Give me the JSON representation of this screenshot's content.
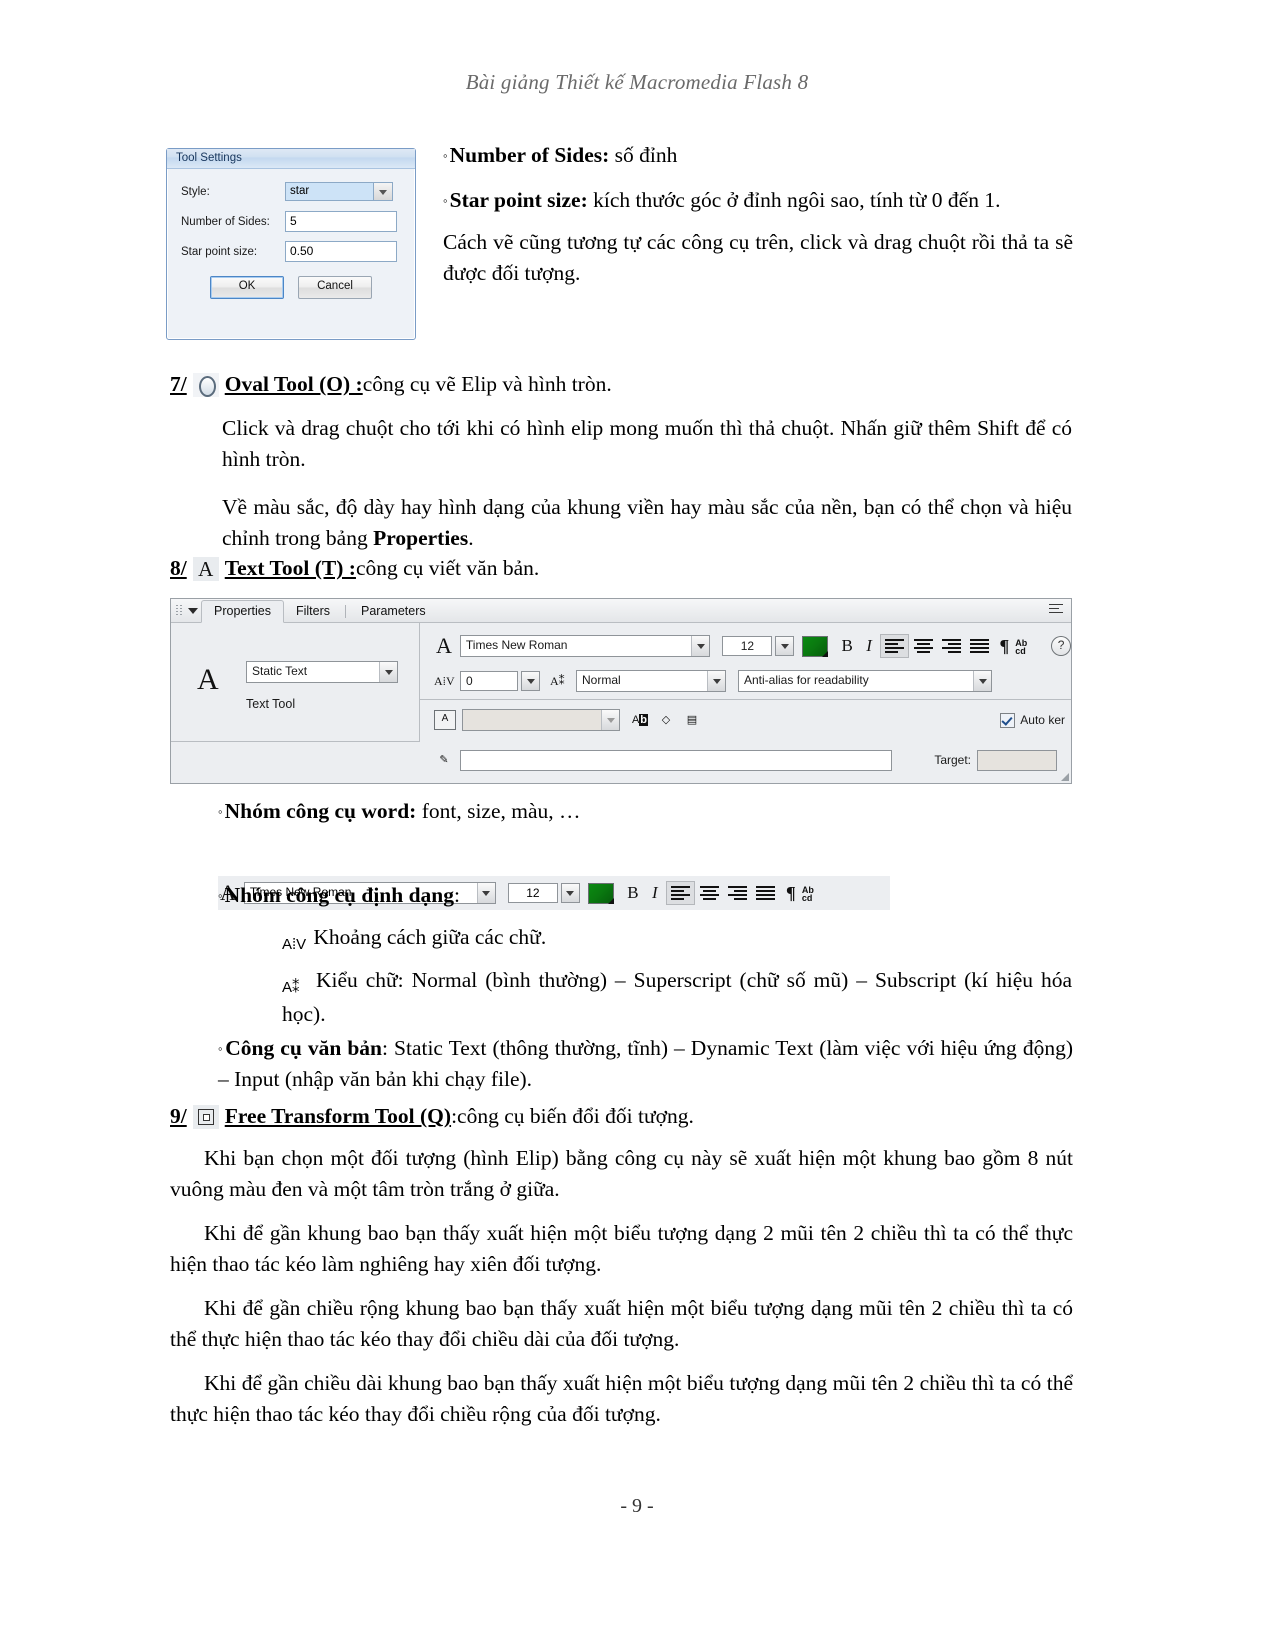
{
  "document": {
    "header": "Bài giảng Thiết kế Macromedia Flash 8",
    "page_number": "- 9 -"
  },
  "tool_settings_dialog": {
    "title": "Tool Settings",
    "fields": [
      {
        "label": "Style:",
        "value": "star",
        "type": "combo"
      },
      {
        "label": "Number of Sides:",
        "value": "5",
        "type": "input"
      },
      {
        "label": "Star point size:",
        "value": "0.50",
        "type": "input"
      }
    ],
    "ok_label": "OK",
    "cancel_label": "Cancel"
  },
  "bullets_top": {
    "b1_term": "Number of Sides:",
    "b1_desc": " số đỉnh",
    "b2_term": "Star point size:",
    "b2_desc": " kích thước góc ở đỉnh ngôi sao, tính từ 0 đến 1.",
    "p1": "Cách vẽ cũng tương tự các công cụ trên, click và drag chuột rồi thả ta sẽ được đối tượng."
  },
  "section_oval": {
    "number": "7/",
    "title": "Oval Tool (O) :",
    "tail": " công cụ vẽ Elip và hình tròn.",
    "p1": "Click và drag chuột cho tới khi có hình elip mong muốn thì thả chuột. Nhấn giữ thêm Shift để có hình tròn.",
    "p2_a": "Về màu sắc, độ dày hay hình dạng của khung viền hay màu sắc của nền, bạn có thể chọn và hiệu chỉnh trong bảng ",
    "p2_b": "Properties",
    "p2_c": "."
  },
  "section_text": {
    "number": "8/",
    "title": "Text Tool (T) :",
    "tail": "công cụ viết văn bản."
  },
  "properties_panel": {
    "tabs": [
      {
        "label": "Properties",
        "active": true
      },
      {
        "label": "Filters",
        "active": false
      },
      {
        "label": "Parameters",
        "active": false
      }
    ],
    "text_type": "Static Text",
    "tool_name": "Text Tool",
    "font_family": "Times New Roman",
    "font_size": "12",
    "text_color": "#0a7a10",
    "letter_spacing": "0",
    "character_position": "Normal",
    "anti_alias": "Anti-alias for readability",
    "url_link": "",
    "auto_kern_label": "Auto ker",
    "auto_kern_checked": true,
    "target_label": "Target:",
    "target_value": "",
    "bold_label": "B",
    "italic_label": "I",
    "pilcrow_label": "¶",
    "help_label": "?",
    "abcd_label": "Ab\ncd"
  },
  "word_toolbar": {
    "font_family": "Times New Roman",
    "font_size": "12",
    "text_color": "#0a7a10",
    "bold_label": "B",
    "italic_label": "I",
    "pilcrow_label": "¶",
    "abcd_label": "Ab\ncd"
  },
  "bullets_mid": {
    "b1_term": "Nhóm công cụ word:",
    "b1_desc": " font, size, màu, …",
    "b2_term": "Nhóm công cụ định dạng",
    "b2_desc": ":",
    "item1": "Khoảng cách giữa các chữ.",
    "item2": "Kiểu chữ: Normal (bình thường) – Superscript (chữ số mũ) – Subscript (kí hiệu hóa học).",
    "b3_term": "Công cụ văn bản",
    "b3_desc": ": Static Text (thông thường, tĩnh) – Dynamic Text (làm việc với hiệu ứng động) – Input (nhập văn bản khi chạy file)."
  },
  "section_transform": {
    "number": "9/",
    "title": "Free Transform Tool (Q)",
    "colon": " :",
    "tail": " công cụ biến đổi đối tượng.",
    "p1": "Khi bạn chọn một đối tượng (hình Elip) bằng công cụ này sẽ xuất hiện một khung bao gồm 8 nút vuông màu đen và một tâm tròn trắng ở giữa.",
    "p2": "Khi để gần khung bao bạn thấy xuất hiện một  biểu tượng dạng 2 mũi tên 2 chiều thì ta có thể thực hiện thao tác kéo làm nghiêng hay xiên đối tượng.",
    "p3": "Khi để gần chiều rộng khung bao bạn thấy xuất hiện một  biểu tượng dạng mũi tên 2 chiều thì ta có thể thực hiện thao tác kéo thay đổi chiều dài của đối tượng.",
    "p4": "Khi để gần chiều dài khung bao bạn thấy xuất hiện một  biểu tượng dạng mũi tên 2 chiều thì ta có thể thực hiện thao tác kéo thay đổi chiều rộng của đối tượng."
  }
}
